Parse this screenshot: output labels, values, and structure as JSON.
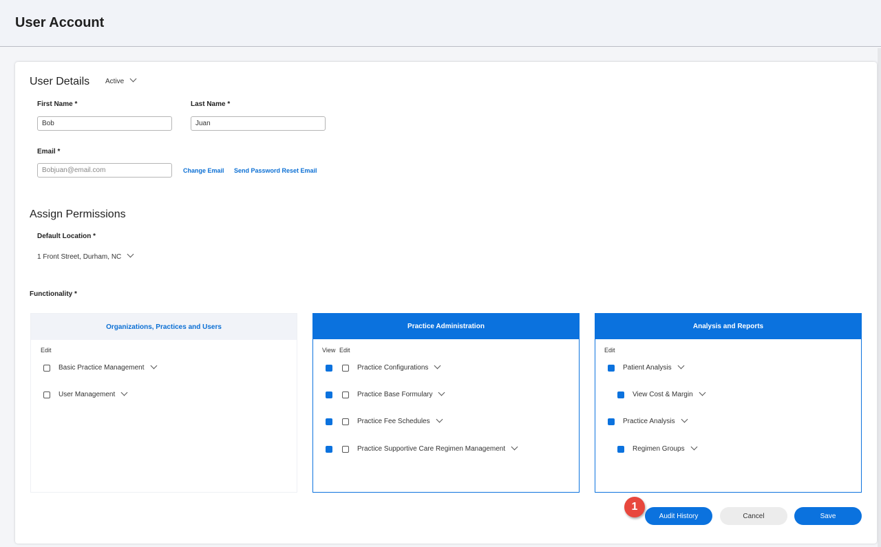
{
  "header": {
    "title": "User Account"
  },
  "user_details": {
    "title": "User Details",
    "status": "Active",
    "first_name_label": "First Name *",
    "first_name": "Bob",
    "last_name_label": "Last Name *",
    "last_name": "Juan",
    "email_label": "Email *",
    "email_placeholder": "Bobjuan@email.com",
    "change_email": "Change Email",
    "reset_email": "Send Password Reset Email"
  },
  "permissions": {
    "title": "Assign Permissions",
    "default_location_label": "Default Location *",
    "default_location": "1 Front Street, Durham, NC",
    "functionality_label": "Functionality *"
  },
  "panels": [
    {
      "title": "Organizations, Practices and Users",
      "sub": "Edit",
      "items": [
        {
          "label": "Basic Practice Management",
          "edit": false
        },
        {
          "label": "User Management",
          "edit": false
        }
      ]
    },
    {
      "title": "Practice Administration",
      "sub_view": "View",
      "sub_edit": "Edit",
      "items": [
        {
          "label": "Practice Configurations",
          "view": true,
          "edit": false
        },
        {
          "label": "Practice Base Formulary",
          "view": true,
          "edit": false
        },
        {
          "label": "Practice Fee Schedules",
          "view": true,
          "edit": false
        },
        {
          "label": "Practice Supportive Care Regimen Management",
          "view": true,
          "edit": false
        }
      ]
    },
    {
      "title": "Analysis and Reports",
      "sub": "Edit",
      "items": [
        {
          "label": "Patient Analysis",
          "edit": true
        },
        {
          "label": "View Cost & Margin",
          "edit": true
        },
        {
          "label": "Practice Analysis",
          "edit": true
        },
        {
          "label": "Regimen Groups",
          "edit": true
        }
      ]
    }
  ],
  "actions": {
    "audit": "Audit History",
    "cancel": "Cancel",
    "save": "Save",
    "badge": "1"
  },
  "colors": {
    "primary": "#0b72de",
    "badge": "#e8473d"
  }
}
